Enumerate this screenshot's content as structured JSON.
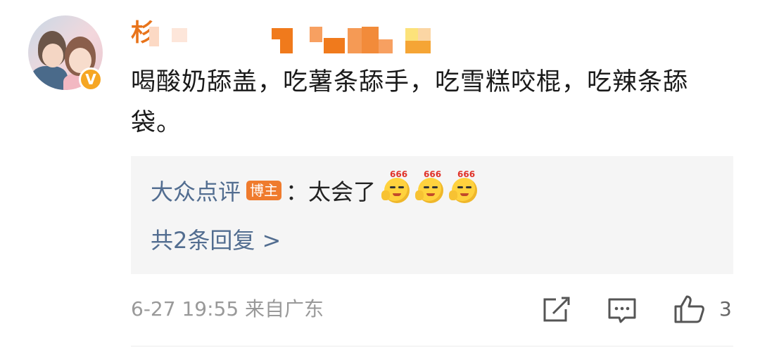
{
  "comment": {
    "username_visible": "杉",
    "text": "喝酸奶舔盖，吃薯条舔手，吃雪糕咬棍，吃辣条舔袋。",
    "verified_badge": "V",
    "timestamp": "6-27 19:55",
    "location": "来自广东",
    "like_count": "3"
  },
  "reply": {
    "author": "大众点评",
    "tag": "博主",
    "text": "：太会了",
    "emoji_label": "666",
    "emojis": [
      "emoji-666",
      "emoji-666",
      "emoji-666"
    ],
    "more": "共2条回复 >"
  },
  "colors": {
    "link": "#526d90",
    "tag_bg": "#ef7b2d",
    "badge": "#f6a623",
    "reply_bg": "#f5f5f5"
  },
  "icons": [
    "verified-icon",
    "edit-icon",
    "comment-icon",
    "thumbs-up-icon",
    "emoji-666-icon"
  ]
}
